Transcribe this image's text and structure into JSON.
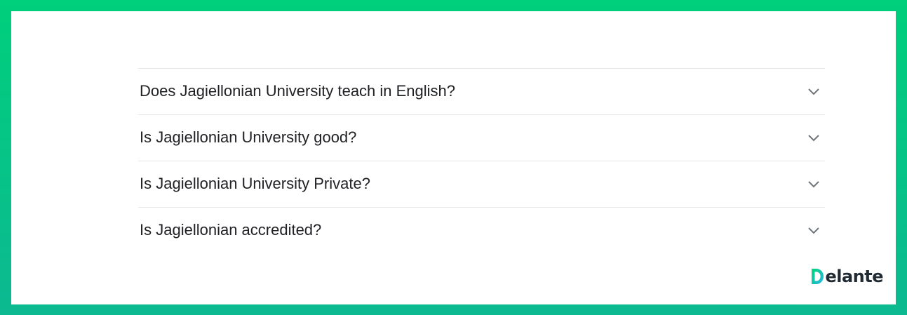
{
  "faq": {
    "items": [
      {
        "question": "Does Jagiellonian University teach in English?",
        "icon": "chevron-down-icon"
      },
      {
        "question": "Is Jagiellonian University good?",
        "icon": "chevron-down-icon"
      },
      {
        "question": "Is Jagiellonian University Private?",
        "icon": "chevron-down-icon"
      },
      {
        "question": "Is Jagiellonian accredited?",
        "icon": "chevron-down-icon"
      }
    ]
  },
  "branding": {
    "logo_text": "elante",
    "logo_mark": "D",
    "colors": {
      "frame_top": "#00cf7c",
      "frame_bottom": "#0cb991",
      "text": "#202124",
      "divider": "#e7e7e7",
      "chevron": "#70757a"
    }
  }
}
